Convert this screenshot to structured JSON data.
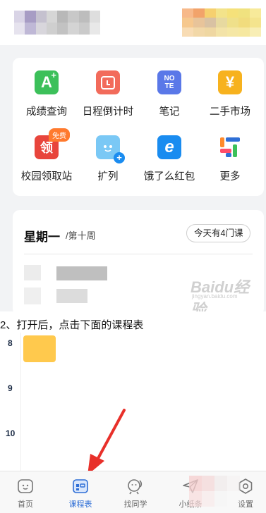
{
  "tools": [
    {
      "label": "成绩查询",
      "icon": "grade-a-plus-icon",
      "color": "#3cc05a",
      "glyph": "A"
    },
    {
      "label": "日程倒计时",
      "icon": "countdown-calendar-icon",
      "color": "#f26b5b",
      "glyph": ""
    },
    {
      "label": "笔记",
      "icon": "note-icon",
      "color": "#5a78e8",
      "glyph": "NOTE"
    },
    {
      "label": "二手市场",
      "icon": "yen-market-icon",
      "color": "#f7b21e",
      "glyph": "¥"
    },
    {
      "label": "校园领取站",
      "icon": "campus-pickup-icon",
      "color": "#e8453c",
      "glyph": "领",
      "badge": "免费"
    },
    {
      "label": "扩列",
      "icon": "add-friend-robot-icon",
      "color": "#7ac8f5",
      "glyph": ""
    },
    {
      "label": "饿了么红包",
      "icon": "eleme-icon",
      "color": "#1a8cf0",
      "glyph": "e"
    },
    {
      "label": "更多",
      "icon": "more-grid-icon",
      "color": "#ffffff",
      "glyph": ""
    }
  ],
  "schedule": {
    "weekday": "星期一",
    "week": "/第十周",
    "courses_today": "今天有4门课"
  },
  "watermark": {
    "main": "Baidu经验",
    "sub": "jingyan.baidu.com"
  },
  "caption": "2、打开后，点击下面的课程表",
  "timetable": {
    "hours": [
      "8",
      "9",
      "10"
    ],
    "block_color": "#ffc94d"
  },
  "tabs": [
    {
      "label": "首页",
      "icon": "home-face-icon",
      "active": false
    },
    {
      "label": "课程表",
      "icon": "timetable-icon",
      "active": true
    },
    {
      "label": "找同学",
      "icon": "find-classmates-icon",
      "active": false
    },
    {
      "label": "小纸条",
      "icon": "paper-plane-icon",
      "active": false
    },
    {
      "label": "设置",
      "icon": "settings-icon",
      "active": false
    }
  ],
  "colors": {
    "accent": "#2f6fd6",
    "arrow": "#e8302a"
  }
}
